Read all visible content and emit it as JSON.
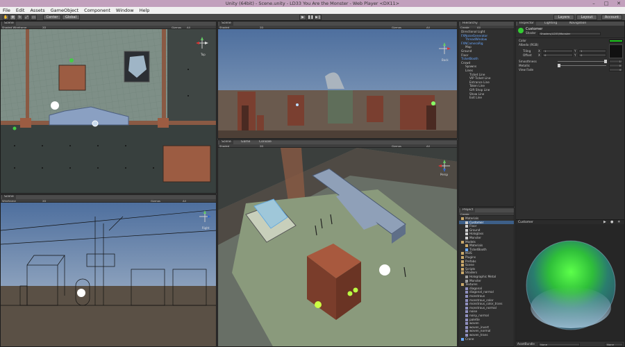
{
  "window": {
    "title": "Unity (64bit) - Scene.unity - LD33 You Are the Monster - Web Player <DX11>"
  },
  "menu": [
    "File",
    "Edit",
    "Assets",
    "GameObject",
    "Component",
    "Window",
    "Help"
  ],
  "toolbar": {
    "pivot": "Center",
    "space": "Global",
    "layers": "Layers",
    "layout": "Layout",
    "account": "Account"
  },
  "scene_top_left": {
    "tab": "Scene",
    "mode": "Shaded Wireframe",
    "mode2": "2D",
    "gizmos": "Gizmos",
    "search": "All",
    "axis": "Top"
  },
  "scene_top_right": {
    "tab": "Scene",
    "mode": "Shaded",
    "mode2": "2D",
    "gizmos": "Gizmos",
    "search": "All",
    "axis": "Back"
  },
  "scene_bottom_left": {
    "tab": "Scene",
    "mode": "Wireframe",
    "mode2": "2D",
    "gizmos": "Gizmos",
    "search": "All",
    "axis": "Right"
  },
  "scene_main": {
    "tabs": [
      "Scene",
      "Game",
      "Console"
    ],
    "mode": "Shaded",
    "mode2": "2D",
    "gizmos": "Gizmos",
    "search": "All",
    "axis": "Persp"
  },
  "hierarchy": {
    "tab": "Hierarchy",
    "create": "Create",
    "search": "All",
    "items": [
      {
        "label": "Directional Light",
        "style": "normal",
        "indent": 0
      },
      {
        "label": "FXNoiseGenerator",
        "style": "blue",
        "indent": 0
      },
      {
        "label": "ThreadWindow",
        "style": "blue",
        "indent": 1
      },
      {
        "label": "FXNCameraRig",
        "style": "blue",
        "indent": 0
      },
      {
        "label": "Map",
        "style": "normal",
        "indent": 1
      },
      {
        "label": "Ground",
        "style": "normal",
        "indent": 0
      },
      {
        "label": "Floor",
        "style": "normal",
        "indent": 0
      },
      {
        "label": "TicketBooth",
        "style": "blue",
        "indent": 0
      },
      {
        "label": "Crowd",
        "style": "normal",
        "indent": 0
      },
      {
        "label": "Spawns",
        "style": "normal",
        "indent": 1
      },
      {
        "label": "Lines",
        "style": "normal",
        "indent": 1
      },
      {
        "label": "Ticket Line",
        "style": "normal",
        "indent": 2
      },
      {
        "label": "VIP Ticket Line",
        "style": "normal",
        "indent": 2
      },
      {
        "label": "Entrance Line",
        "style": "normal",
        "indent": 2
      },
      {
        "label": "Token Line",
        "style": "normal",
        "indent": 2
      },
      {
        "label": "Gift Shop Line",
        "style": "normal",
        "indent": 2
      },
      {
        "label": "Show Line",
        "style": "normal",
        "indent": 2
      },
      {
        "label": "Exit Line",
        "style": "normal",
        "indent": 2
      }
    ]
  },
  "project": {
    "tab": "Project",
    "create": "Create",
    "items": [
      {
        "label": "Materials",
        "type": "folder",
        "indent": 0,
        "selected": false
      },
      {
        "label": "Customer",
        "type": "mat",
        "indent": 1,
        "selected": true
      },
      {
        "label": "Floor",
        "type": "mat",
        "indent": 1,
        "selected": false
      },
      {
        "label": "Ground",
        "type": "mat",
        "indent": 1,
        "selected": false
      },
      {
        "label": "Hologlass",
        "type": "mat",
        "indent": 1,
        "selected": false
      },
      {
        "label": "Monster",
        "type": "mat",
        "indent": 1,
        "selected": false
      },
      {
        "label": "Models",
        "type": "folder",
        "indent": 0,
        "selected": false
      },
      {
        "label": "Materials",
        "type": "folder",
        "indent": 1,
        "selected": false
      },
      {
        "label": "TicketBooth",
        "type": "model",
        "indent": 1,
        "selected": false
      },
      {
        "label": "NSIS",
        "type": "folder",
        "indent": 0,
        "selected": false
      },
      {
        "label": "Plugins",
        "type": "folder",
        "indent": 0,
        "selected": false
      },
      {
        "label": "Prefabs",
        "type": "folder",
        "indent": 0,
        "selected": false
      },
      {
        "label": "Scene",
        "type": "folder",
        "indent": 0,
        "selected": false
      },
      {
        "label": "Scripts",
        "type": "folder",
        "indent": 0,
        "selected": false
      },
      {
        "label": "Shaders",
        "type": "folder",
        "indent": 0,
        "selected": false
      },
      {
        "label": "Holographic Metal",
        "type": "shader",
        "indent": 1,
        "selected": false
      },
      {
        "label": "Monster",
        "type": "shader",
        "indent": 1,
        "selected": false
      },
      {
        "label": "Textures",
        "type": "folder",
        "indent": 0,
        "selected": false
      },
      {
        "label": "diagonal",
        "type": "tex",
        "indent": 1,
        "selected": false
      },
      {
        "label": "diagonal_normal",
        "type": "tex",
        "indent": 1,
        "selected": false
      },
      {
        "label": "monstrous",
        "type": "tex",
        "indent": 1,
        "selected": false
      },
      {
        "label": "monstrous_color",
        "type": "tex",
        "indent": 1,
        "selected": false
      },
      {
        "label": "monstrous_color_trans",
        "type": "tex",
        "indent": 1,
        "selected": false
      },
      {
        "label": "monstrous_normal",
        "type": "tex",
        "indent": 1,
        "selected": false
      },
      {
        "label": "noise",
        "type": "tex",
        "indent": 1,
        "selected": false
      },
      {
        "label": "noisy_normal",
        "type": "tex",
        "indent": 1,
        "selected": false
      },
      {
        "label": "palette",
        "type": "tex",
        "indent": 1,
        "selected": false
      },
      {
        "label": "woven",
        "type": "tex",
        "indent": 1,
        "selected": false
      },
      {
        "label": "woven_invert",
        "type": "tex",
        "indent": 1,
        "selected": false
      },
      {
        "label": "woven_normal",
        "type": "tex",
        "indent": 1,
        "selected": false
      },
      {
        "label": "woven_trans",
        "type": "tex",
        "indent": 1,
        "selected": false
      },
      {
        "label": "Crane",
        "type": "model",
        "indent": 0,
        "selected": false
      }
    ]
  },
  "inspector": {
    "tabs": [
      "Inspector",
      "Lighting",
      "Navigation"
    ],
    "object": "Customer",
    "shader_label": "Shader",
    "shader": "Shaders/LD33/Monster",
    "color": "Color",
    "albedo": "Albedo (RGB)",
    "tiling": "Tiling",
    "offset": "Offset",
    "smoothness": "Smoothness",
    "metallic": "Metallic",
    "view_fade": "View Fade",
    "x": "X",
    "y": "Y",
    "tiling_x": "1",
    "tiling_y": "1",
    "offset_x": "0",
    "offset_y": "0",
    "smoothness_val": "1",
    "metallic_val": "0",
    "view_fade_val": "4",
    "preview_title": "Customer",
    "assetbundle_label": "AssetBundle",
    "assetbundle_val": "None",
    "assetbundle_val2": "None"
  },
  "colors": {
    "accent": "#3d5f88",
    "title_bar": "#c2a0bd",
    "green_swatch": "#22cc22"
  }
}
